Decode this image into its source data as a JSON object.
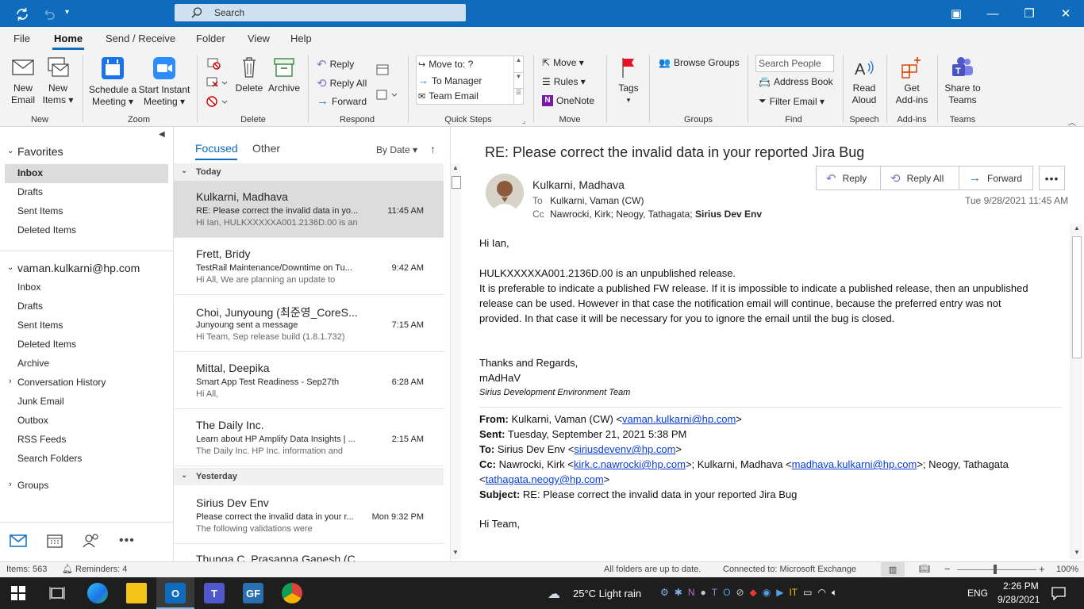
{
  "titlebar": {
    "search_placeholder": "Search"
  },
  "tabs": [
    {
      "label": "File"
    },
    {
      "label": "Home"
    },
    {
      "label": "Send / Receive"
    },
    {
      "label": "Folder"
    },
    {
      "label": "View"
    },
    {
      "label": "Help"
    }
  ],
  "ribbon": {
    "new_email": "New\nEmail",
    "new_email_1": "New",
    "new_email_2": "Email",
    "new_items_1": "New",
    "new_items_2": "Items ▾",
    "schedule_1": "Schedule a",
    "schedule_2": "Meeting ▾",
    "instant_1": "Start Instant",
    "instant_2": "Meeting ▾",
    "delete": "Delete",
    "archive": "Archive",
    "reply": "Reply",
    "reply_all": "Reply All",
    "forward": "Forward",
    "qs_move_to": "Move to: ?",
    "qs_to_manager": "To Manager",
    "qs_team_email": "Team Email",
    "move": "Move ▾",
    "rules": "Rules ▾",
    "onenote": "OneNote",
    "tags": "Tags",
    "browse_groups": "Browse Groups",
    "search_people_placeholder": "Search People",
    "address_book": "Address Book",
    "filter_email": "Filter Email ▾",
    "read_aloud_1": "Read",
    "read_aloud_2": "Aloud",
    "get_addins_1": "Get",
    "get_addins_2": "Add-ins",
    "share_teams_1": "Share to",
    "share_teams_2": "Teams",
    "groups": {
      "new": "New",
      "zoom": "Zoom",
      "delete": "Delete",
      "respond": "Respond",
      "quick_steps": "Quick Steps",
      "move": "Move",
      "groups": "Groups",
      "find": "Find",
      "speech": "Speech",
      "addins": "Add-ins",
      "teams": "Teams"
    }
  },
  "nav": {
    "favorites": "Favorites",
    "fav_items": [
      "Inbox",
      "Drafts",
      "Sent Items",
      "Deleted Items"
    ],
    "account": "vaman.kulkarni@hp.com",
    "acct_items": [
      "Inbox",
      "Drafts",
      "Sent Items",
      "Deleted Items",
      "Archive",
      "Conversation History",
      "Junk Email",
      "Outbox",
      "RSS Feeds",
      "Search Folders"
    ],
    "groups": "Groups"
  },
  "list": {
    "focused": "Focused",
    "other": "Other",
    "sort": "By Date ▾",
    "today": "Today",
    "yesterday": "Yesterday",
    "messages": [
      {
        "from": "Kulkarni, Madhava",
        "subject": "RE: Please correct the invalid data in yo...",
        "preview": "Hi Ian,  HULKXXXXXA001.2136D.00 is an",
        "time": "11:45 AM"
      },
      {
        "from": "Frett, Bridy",
        "subject": "TestRail Maintenance/Downtime on Tu...",
        "preview": "Hi All,  We are planning an update to",
        "time": "9:42 AM"
      },
      {
        "from": "Choi, Junyoung (최준영_CoreS...",
        "subject": "Junyoung sent a message",
        "preview": "Hi Team,   Sep release build (1.8.1.732)",
        "time": "7:15 AM"
      },
      {
        "from": "Mittal, Deepika",
        "subject": "Smart App Test Readiness - Sep27th",
        "preview": "Hi All,",
        "time": "6:28 AM"
      },
      {
        "from": "The Daily Inc.",
        "subject": "Learn about HP Amplify Data Insights | ...",
        "preview": "The Daily Inc.  HP Inc. information and",
        "time": "2:15 AM"
      },
      {
        "from": "Sirius Dev Env",
        "subject": "Please correct the invalid data in your r...",
        "preview": "The following validations were",
        "time": "Mon 9:32 PM"
      },
      {
        "from": "Thunga C, Prasanna Ganesh (C...",
        "subject": "",
        "preview": "",
        "time": ""
      }
    ]
  },
  "reading": {
    "subject": "RE: Please correct the invalid data in your reported Jira Bug",
    "sender": "Kulkarni, Madhava",
    "to_label": "To",
    "to": "Kulkarni, Vaman (CW)",
    "cc_label": "Cc",
    "cc": "Nawrocki, Kirk; Neogy, Tathagata;",
    "cc_bold": "Sirius Dev Env",
    "date": "Tue 9/28/2021 11:45 AM",
    "reply": "Reply",
    "reply_all": "Reply All",
    "forward": "Forward",
    "greeting": "Hi Ian,",
    "p1": "HULKXXXXXA001.2136D.00 is an unpublished release.",
    "p2a": "It is preferable to indicate a published FW release.  If it is impossible to indicate a published release, then an unpublished",
    "p2b": "release can be used.  However in that case the notification email will continue, because the preferred entry was not",
    "p2c": "provided.  In that case it will be necessary for you to ignore the email until the bug is closed.",
    "thanks": "Thanks and Regards,",
    "sign": "mAdHaV",
    "team": "Sirius Development Environment Team",
    "q_from_label": "From:",
    "q_from": "Kulkarni, Vaman (CW) <",
    "q_from_email": "vaman.kulkarni@hp.com",
    "q_from_end": ">",
    "q_sent_label": "Sent:",
    "q_sent": "Tuesday, September 21, 2021 5:38 PM",
    "q_to_label": "To:",
    "q_to": "Sirius Dev Env <",
    "q_to_email": "siriusdevenv@hp.com",
    "q_to_end": ">",
    "q_cc_label": "Cc:",
    "q_cc1": "Nawrocki, Kirk <",
    "q_cc1_email": "kirk.c.nawrocki@hp.com",
    "q_cc2": ">; Kulkarni, Madhava <",
    "q_cc2_email": "madhava.kulkarni@hp.com",
    "q_cc3": ">; Neogy, Tathagata",
    "q_cc4": "<",
    "q_cc4_email": "tathagata.neogy@hp.com",
    "q_cc4_end": ">",
    "q_subject_label": "Subject:",
    "q_subject": "RE: Please correct the invalid data in your reported Jira Bug",
    "q_greeting": "Hi Team,"
  },
  "status": {
    "items": "Items: 563",
    "reminders": "Reminders: 4",
    "sync": "All folders are up to date.",
    "connected": "Connected to: Microsoft Exchange",
    "zoom": "100%"
  },
  "taskbar": {
    "weather": "25°C  Light rain",
    "lang": "ENG",
    "time": "2:26 PM",
    "date": "9/28/2021"
  },
  "colors": {
    "accent": "#0f6cbd",
    "selected": "#dcdcdc",
    "link": "#0b3fd6"
  }
}
